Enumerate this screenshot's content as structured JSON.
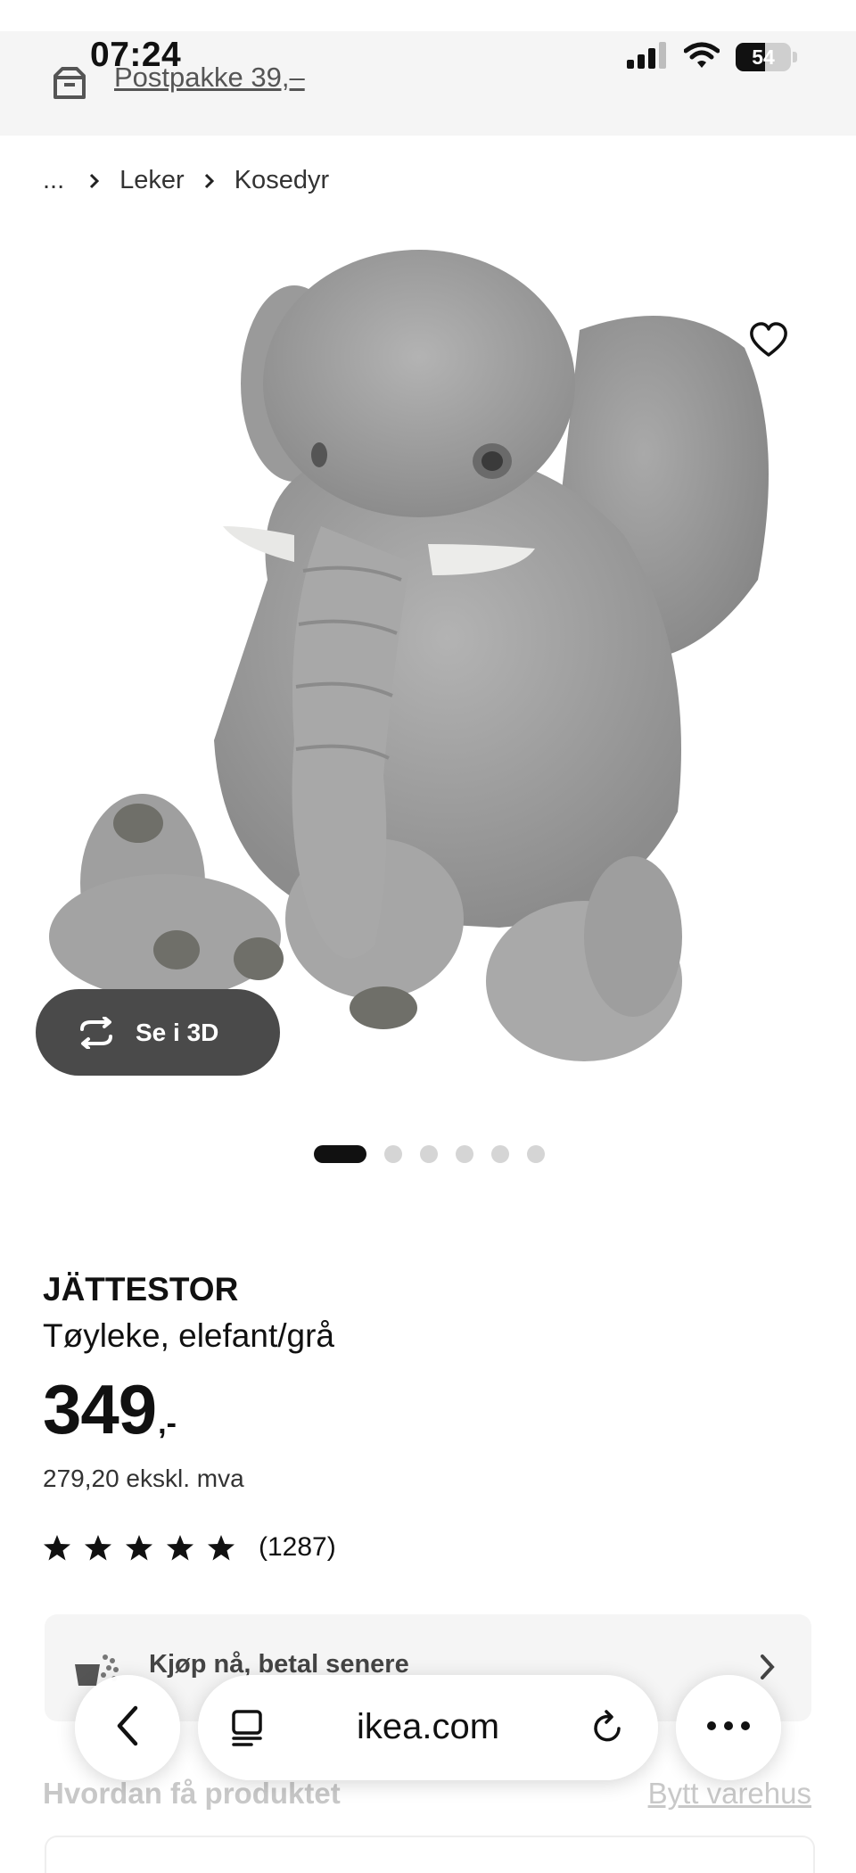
{
  "status_bar": {
    "time": "07:24",
    "battery_level": "54",
    "battery_fraction": 0.54
  },
  "delivery_banner": {
    "text": "Postpakke 39,–",
    "icon": "parcel-icon"
  },
  "breadcrumb": {
    "items": [
      "...",
      "Leker",
      "Kosedyr"
    ]
  },
  "gallery": {
    "view_3d_label": "Se i 3D",
    "slide_count": 6,
    "active_slide": 1,
    "image_subject": "elephant-plush-image"
  },
  "product": {
    "name": "JÄTTESTOR",
    "description": "Tøyleke, elefant/grå",
    "price": "349",
    "price_suffix": ",-",
    "price_ex_vat": "279,20 ekskl. mva",
    "rating_stars": 5,
    "review_count": "(1287)"
  },
  "klarna": {
    "label": "Kjøp nå, betal senere"
  },
  "delivery_section": {
    "title": "Hvordan få produktet",
    "change_store": "Bytt varehus"
  },
  "browser": {
    "url": "ikea.com"
  },
  "colors": {
    "banner_bg": "#f5f5f5",
    "button_dark": "#4a4a4a",
    "text": "#111111",
    "card_bg": "#f5f5f5"
  }
}
